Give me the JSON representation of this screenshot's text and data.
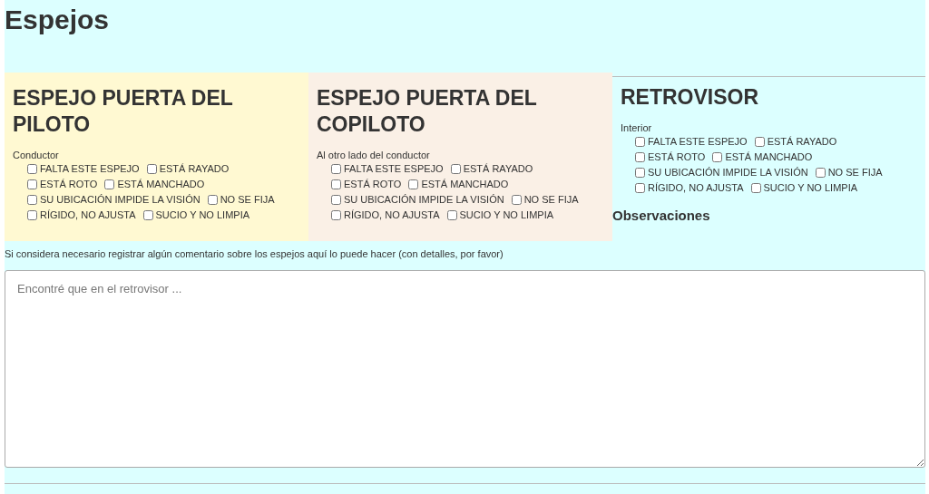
{
  "title": "Espejos",
  "sections": [
    {
      "heading": "ESPEJO PUERTA DEL PILOTO",
      "subtitle": "Conductor",
      "color": "#fff9d2",
      "options": [
        {
          "label": "FALTA ESTE ESPEJO",
          "checked": false
        },
        {
          "label": "ESTÁ RAYADO",
          "checked": false
        },
        {
          "label": "ESTÁ ROTO",
          "checked": false
        },
        {
          "label": "ESTÁ MANCHADO",
          "checked": false
        },
        {
          "label": "SU UBICACIÓN IMPIDE LA VISIÓN",
          "checked": false
        },
        {
          "label": "NO SE FIJA",
          "checked": false
        },
        {
          "label": "RÍGIDO, NO AJUSTA",
          "checked": false
        },
        {
          "label": "SUCIO Y NO LIMPIA",
          "checked": false
        }
      ]
    },
    {
      "heading": "ESPEJO PUERTA DEL COPILOTO",
      "subtitle": "Al otro lado del conductor",
      "color": "#faf0e6",
      "options": [
        {
          "label": "FALTA ESTE ESPEJO",
          "checked": false
        },
        {
          "label": "ESTÁ RAYADO",
          "checked": false
        },
        {
          "label": "ESTÁ ROTO",
          "checked": false
        },
        {
          "label": "ESTÁ MANCHADO",
          "checked": false
        },
        {
          "label": "SU UBICACIÓN IMPIDE LA VISIÓN",
          "checked": false
        },
        {
          "label": "NO SE FIJA",
          "checked": false
        },
        {
          "label": "RÍGIDO, NO AJUSTA",
          "checked": false
        },
        {
          "label": "SUCIO Y NO LIMPIA",
          "checked": false
        }
      ]
    },
    {
      "heading": "RETROVISOR",
      "subtitle": "Interior",
      "options": [
        {
          "label": "FALTA ESTE ESPEJO",
          "checked": false
        },
        {
          "label": "ESTÁ RAYADO",
          "checked": false
        },
        {
          "label": "ESTÁ ROTO",
          "checked": false
        },
        {
          "label": "ESTÁ MANCHADO",
          "checked": false
        },
        {
          "label": "SU UBICACIÓN IMPIDE LA VISIÓN",
          "checked": false
        },
        {
          "label": "NO SE FIJA",
          "checked": false
        },
        {
          "label": "RÍGIDO, NO AJUSTA",
          "checked": false
        },
        {
          "label": "SUCIO Y NO LIMPIA",
          "checked": false
        }
      ]
    }
  ],
  "observations": {
    "heading": "Observaciones",
    "hint": "Si considera necesario registrar algún comentario sobre los espejos aquí lo puede hacer (con detalles, por favor)",
    "placeholder": "Encontré que en el retrovisor ..."
  }
}
